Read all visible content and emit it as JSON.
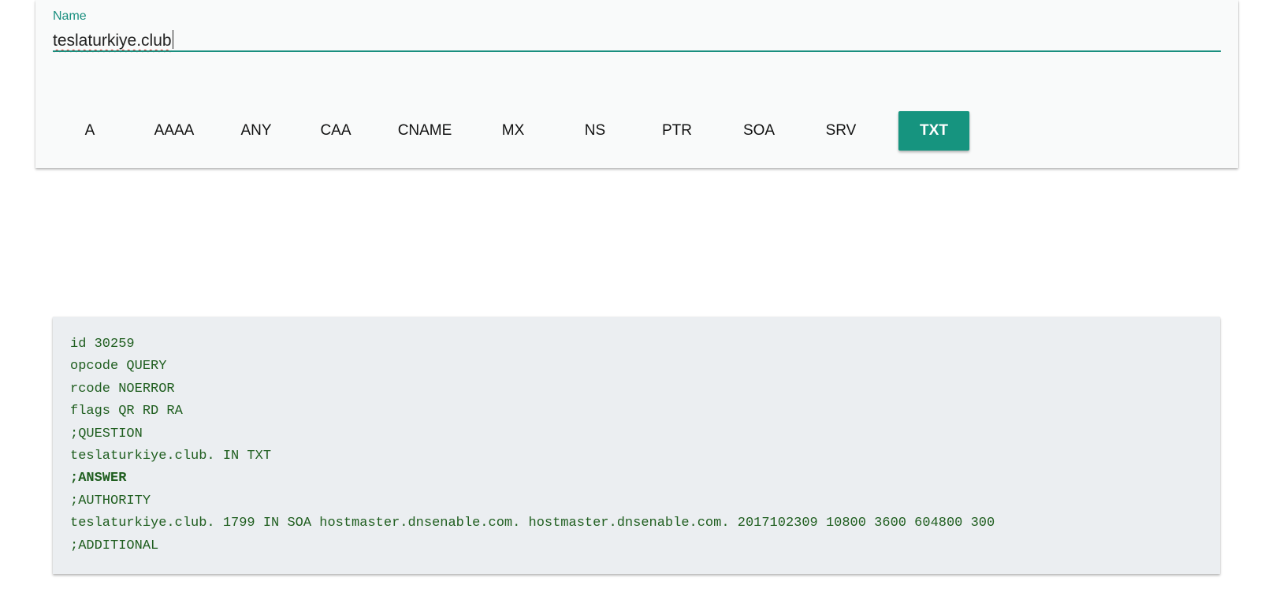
{
  "query": {
    "name_label": "Name",
    "name_value": "teslaturkiye.club",
    "record_types": [
      {
        "label": "A",
        "active": false
      },
      {
        "label": "AAAA",
        "active": false
      },
      {
        "label": "ANY",
        "active": false
      },
      {
        "label": "CAA",
        "active": false
      },
      {
        "label": "CNAME",
        "active": false
      },
      {
        "label": "MX",
        "active": false
      },
      {
        "label": "NS",
        "active": false
      },
      {
        "label": "PTR",
        "active": false
      },
      {
        "label": "SOA",
        "active": false
      },
      {
        "label": "SRV",
        "active": false
      },
      {
        "label": "TXT",
        "active": true
      }
    ]
  },
  "result": {
    "lines": [
      {
        "text": "id 30259",
        "bold": false
      },
      {
        "text": "opcode QUERY",
        "bold": false
      },
      {
        "text": "rcode NOERROR",
        "bold": false
      },
      {
        "text": "flags QR RD RA",
        "bold": false
      },
      {
        "text": ";QUESTION",
        "bold": false
      },
      {
        "text": "teslaturkiye.club. IN TXT",
        "bold": false
      },
      {
        "text": ";ANSWER",
        "bold": true
      },
      {
        "text": ";AUTHORITY",
        "bold": false
      },
      {
        "text": "teslaturkiye.club. 1799 IN SOA hostmaster.dnsenable.com. hostmaster.dnsenable.com. 2017102309 10800 3600 604800 300",
        "bold": false
      },
      {
        "text": ";ADDITIONAL",
        "bold": false
      }
    ]
  },
  "colors": {
    "accent": "#16947f",
    "result_text": "#1f5e1f",
    "result_bg": "#ebeef1"
  }
}
